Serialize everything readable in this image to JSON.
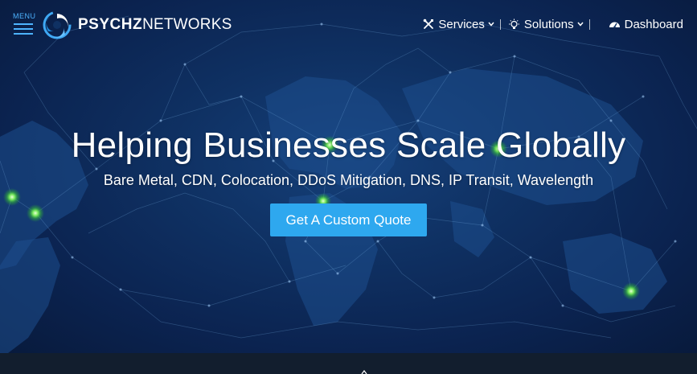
{
  "menu": {
    "label": "MENU"
  },
  "logo": {
    "bold": "PSYCHZ",
    "thin": "NETWORKS"
  },
  "nav": {
    "items": [
      {
        "label": "Services",
        "icon": "wrench-screwdriver-icon",
        "has_dropdown": true
      },
      {
        "label": "Solutions",
        "icon": "lightbulb-icon",
        "has_dropdown": true
      },
      {
        "label": "Dashboard",
        "icon": "speedometer-icon",
        "has_dropdown": false
      }
    ]
  },
  "hero": {
    "headline": "Helping Businesses Scale Globally",
    "subheadline": "Bare Metal, CDN, Colocation, DDoS Mitigation, DNS, IP Transit, Wavelength",
    "cta_label": "Get A Custom Quote",
    "background": "world-network-map"
  },
  "colors": {
    "accent": "#2ea8ef",
    "menu_blue": "#4db3ff",
    "hero_dark": "#0b2350",
    "node_green": "#6ef05a",
    "strip": "#121e2e"
  }
}
